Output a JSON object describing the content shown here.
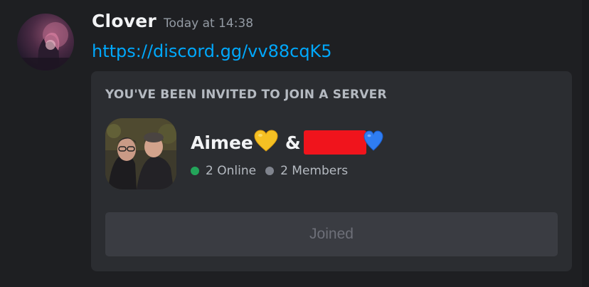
{
  "message": {
    "author": "Clover",
    "timestamp": "Today at 14:38",
    "link_text": "https://discord.gg/vv88cqK5"
  },
  "invite": {
    "heading": "YOU'VE BEEN INVITED TO JOIN A SERVER",
    "server_name": "Aimee",
    "name_separator": "&",
    "online_text": "2 Online",
    "members_text": "2 Members",
    "button_label": "Joined"
  },
  "icons": {
    "heart_1": "yellow-heart-emoji",
    "heart_2": "blue-heart-emoji",
    "status_online": "green-dot-icon",
    "status_members": "grey-dot-icon"
  },
  "colors": {
    "background": "#1e1f22",
    "card": "#2b2d31",
    "link": "#00a8fc",
    "online": "#23a55a",
    "members_dot": "#80848e",
    "redaction": "#f0141c",
    "yellow_heart": "#f5c023",
    "blue_heart": "#2f7df2"
  }
}
